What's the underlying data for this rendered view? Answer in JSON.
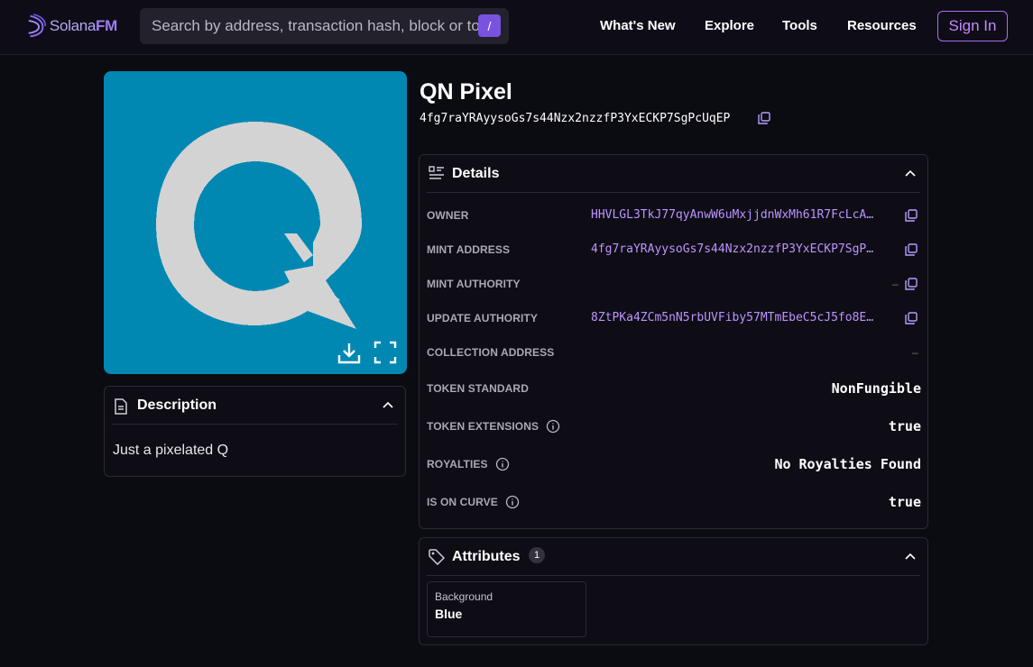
{
  "header": {
    "logo_prefix": "Solana",
    "logo_suffix": "FM",
    "search_placeholder": "Search by address, transaction hash, block or token",
    "search_shortcut": "/",
    "nav": [
      "What's New",
      "Explore",
      "Tools",
      "Resources"
    ],
    "sign_in": "Sign In"
  },
  "token": {
    "name": "QN Pixel",
    "address": "4fg7raYRAyysoGs7s44Nzx2nzzfP3YxECKP7SgPcUqEP",
    "image_bg": "#0088b3"
  },
  "description": {
    "title": "Description",
    "text": "Just a pixelated Q"
  },
  "details": {
    "title": "Details",
    "owner_label": "OWNER",
    "owner": "HHVLGL3TkJ77qyAnwW6uMxjjdnWxMh61R7FcLcA…",
    "mint_address_label": "MINT ADDRESS",
    "mint_address": "4fg7raYRAyysoGs7s44Nzx2nzzfP3YxECKP7SgP…",
    "mint_authority_label": "MINT AUTHORITY",
    "mint_authority": "–",
    "update_authority_label": "UPDATE AUTHORITY",
    "update_authority": "8ZtPKa4ZCm5nN5rbUVFiby57MTmEbeC5cJ5fo8E…",
    "collection_address_label": "COLLECTION ADDRESS",
    "collection_address": "–",
    "token_standard_label": "TOKEN STANDARD",
    "token_standard": "NonFungible",
    "token_extensions_label": "TOKEN EXTENSIONS",
    "token_extensions": "true",
    "royalties_label": "ROYALTIES",
    "royalties": "No Royalties Found",
    "is_on_curve_label": "IS ON CURVE",
    "is_on_curve": "true"
  },
  "attributes": {
    "title": "Attributes",
    "count": "1",
    "items": [
      {
        "trait": "Background",
        "value": "Blue"
      }
    ]
  },
  "colors": {
    "accent": "#7a52e0",
    "link": "#bd93ff",
    "background": "#0b0b12"
  }
}
